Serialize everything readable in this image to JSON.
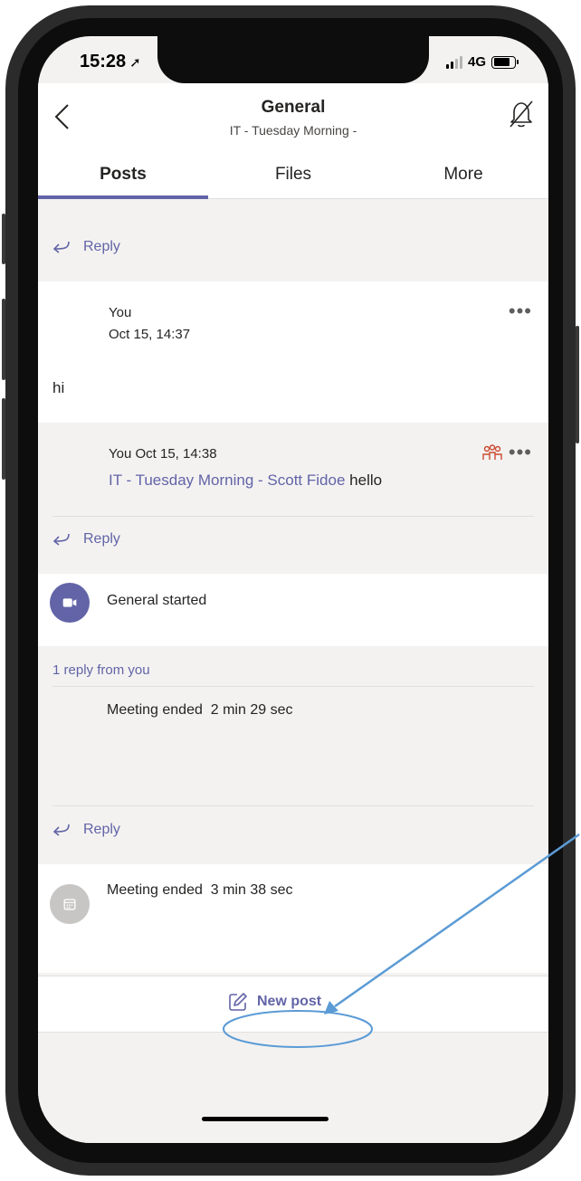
{
  "status_bar": {
    "time": "15:28",
    "location_icon": "location-arrow-icon",
    "network": "4G"
  },
  "header": {
    "title": "General",
    "subtitle": "IT - Tuesday Morning -",
    "back_icon": "chevron-left-icon",
    "mute_icon": "bell-off-icon"
  },
  "tabs": [
    {
      "label": "Posts",
      "active": true
    },
    {
      "label": "Files",
      "active": false
    },
    {
      "label": "More",
      "active": false
    }
  ],
  "feed": {
    "reply_label": "Reply",
    "post1": {
      "author": "You",
      "time": "Oct 15, 14:37",
      "body": "hi",
      "more": "•••",
      "reply": {
        "author_time": "You Oct 15, 14:38",
        "mention": "IT - Tuesday Morning - Scott Fidoe",
        "text": "hello",
        "more": "•••"
      }
    },
    "post2": {
      "text": "General started",
      "replies_link": "1 reply from you",
      "reply_text": "Meeting ended",
      "reply_duration": "2 min 29 sec"
    },
    "post3": {
      "text": "Meeting ended",
      "duration": "3 min 38 sec"
    }
  },
  "new_post": {
    "label": "New post",
    "icon": "compose-icon"
  },
  "colors": {
    "accent": "#6264a7",
    "background": "#f3f2f1",
    "mention_team": "#cc4a31",
    "annotation": "#5b9bd5"
  }
}
